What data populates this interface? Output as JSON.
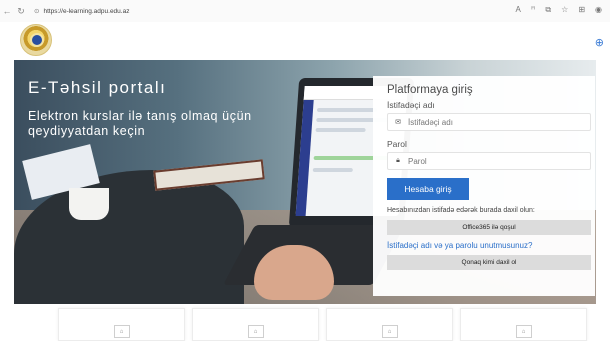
{
  "browser": {
    "url": "https://e-learning.adpu.edu.az"
  },
  "hero": {
    "title": "E-Təhsil portalı",
    "subtitle": "Elektron kurslar ilə tanış olmaq üçün qeydiyyatdan keçin"
  },
  "login": {
    "heading": "Platformaya giriş",
    "username_label": "İstifadəçi adı",
    "username_placeholder": "İstifadəçi adı",
    "password_label": "Parol",
    "password_placeholder": "Parol",
    "submit_label": "Hesaba giriş",
    "office_note": "Hesabınızdan istifadə edərək burada daxil olun:",
    "office_button": "Office365 ilə qoşul",
    "forgot_link": "İstifadəçi adı və ya parolu unutmusunuz?",
    "guest_button": "Qonaq kimi daxil ol"
  },
  "icons": {
    "back": "back-arrow-icon",
    "reload": "reload-icon",
    "lock": "lock-icon",
    "user": "envelope-icon",
    "password": "padlock-icon",
    "language": "globe-icon"
  },
  "colors": {
    "accent": "#2a6fc9",
    "gray_button": "#dcdcdc"
  }
}
